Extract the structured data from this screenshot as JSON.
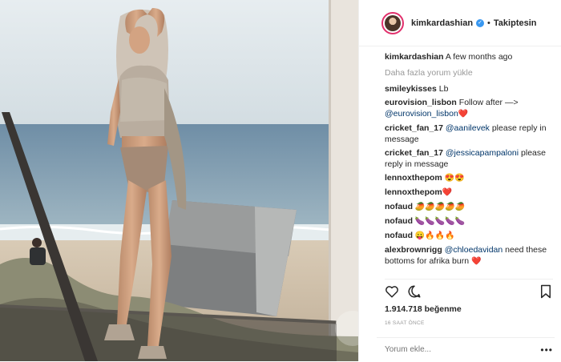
{
  "post": {
    "username": "kimkardashian",
    "follow_separator": "•",
    "follow_label": "Takiptesin",
    "verified_glyph": "✓"
  },
  "caption": {
    "username": "kimkardashian",
    "text": "A few months ago"
  },
  "load_more": "Daha fazla yorum yükle",
  "comments": [
    {
      "user": "smileykisses",
      "text": "Lb"
    },
    {
      "user": "eurovision_lisbon",
      "text": "Follow after —> ",
      "mention": "@eurovision_lisbon",
      "after": "",
      "emoji": "❤️"
    },
    {
      "user": "cricket_fan_17",
      "text": "",
      "mention": "@aanilevek",
      "after": " please reply in message"
    },
    {
      "user": "cricket_fan_17",
      "text": "",
      "mention": "@jessicapampaloni",
      "after": " please reply in message"
    },
    {
      "user": "lennoxthepom",
      "emoji": "😍😍"
    },
    {
      "user": "lennoxthepom",
      "emoji": "❤️"
    },
    {
      "user": "nofaud",
      "emoji": "🥭🥭🥭🥭🥭"
    },
    {
      "user": "nofaud",
      "emoji": "🍆🍆🍆🍆🍆"
    },
    {
      "user": "nofaud",
      "emoji": "😛🔥🔥🔥"
    },
    {
      "user": "alexbrownrigg",
      "text": "",
      "mention": "@chloedavidan",
      "after": " need these bottoms for afrika burn",
      "emoji": "❤️"
    }
  ],
  "likes": "1.914.718 beğenme",
  "timestamp": "16 SAAT ÖNCE",
  "comment_input": {
    "placeholder": "Yorum ekle..."
  },
  "more_menu": "•••",
  "icons": {
    "like": "heart-outline-icon",
    "comment": "speech-bubble-icon",
    "more": "ellipsis-icon"
  },
  "colors": {
    "link": "#003569",
    "verified": "#3897f0",
    "muted": "#999999",
    "text": "#262626"
  }
}
